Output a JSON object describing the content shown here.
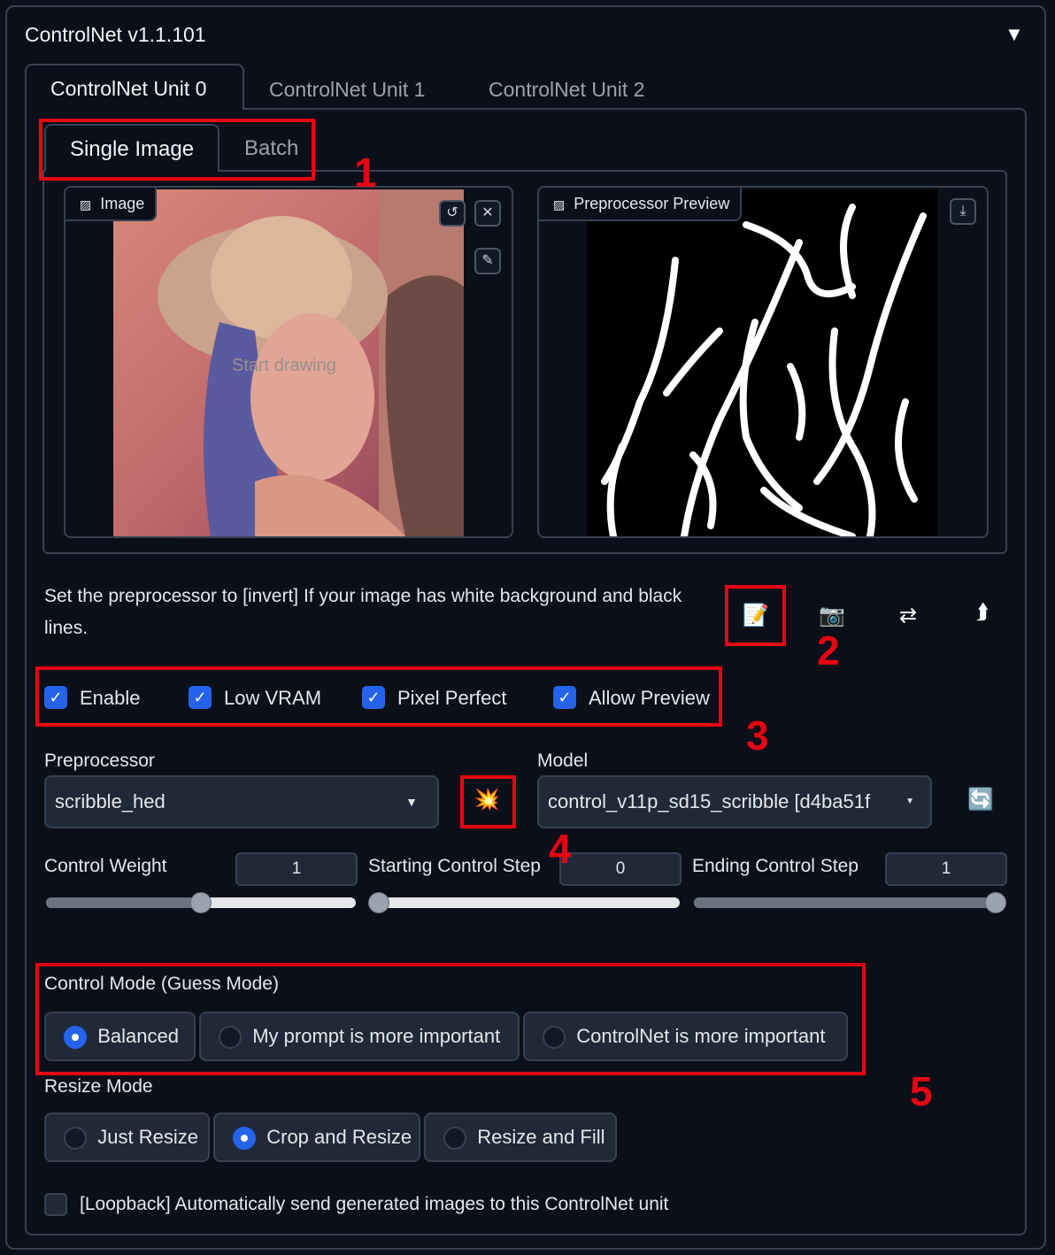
{
  "header": {
    "title": "ControlNet v1.1.101",
    "collapse_icon": "▼"
  },
  "unit_tabs": [
    "ControlNet Unit 0",
    "ControlNet Unit 1",
    "ControlNet Unit 2"
  ],
  "sub_tabs": [
    "Single Image",
    "Batch"
  ],
  "image_panel": {
    "label": "Image",
    "overlay_text": "Start drawing"
  },
  "preview_panel": {
    "label": "Preprocessor Preview"
  },
  "info_text": "Set the preprocessor to [invert] If your image has white background and black lines.",
  "tool_icons": {
    "notepad": "📝",
    "camera": "📷",
    "swap": "⇄",
    "send": "⮭"
  },
  "checkboxes": [
    {
      "label": "Enable",
      "checked": true
    },
    {
      "label": "Low VRAM",
      "checked": true
    },
    {
      "label": "Pixel Perfect",
      "checked": true
    },
    {
      "label": "Allow Preview",
      "checked": true
    }
  ],
  "preprocessor": {
    "label": "Preprocessor",
    "value": "scribble_hed",
    "run_icon": "💥"
  },
  "model": {
    "label": "Model",
    "value": "control_v11p_sd15_scribble [d4ba51f",
    "refresh_icon": "🔄"
  },
  "sliders": [
    {
      "label": "Control Weight",
      "value": "1",
      "fraction": 0.5
    },
    {
      "label": "Starting Control Step",
      "value": "0",
      "fraction": 0.0
    },
    {
      "label": "Ending Control Step",
      "value": "1",
      "fraction": 1.0
    }
  ],
  "control_mode": {
    "label": "Control Mode (Guess Mode)",
    "options": [
      "Balanced",
      "My prompt is more important",
      "ControlNet is more important"
    ],
    "selected": "Balanced"
  },
  "resize_mode": {
    "label": "Resize Mode",
    "options": [
      "Just Resize",
      "Crop and Resize",
      "Resize and Fill"
    ],
    "selected": "Crop and Resize"
  },
  "loopback": {
    "label": "[Loopback] Automatically send generated images to this ControlNet unit",
    "checked": false
  },
  "annotations": [
    "1",
    "2",
    "3",
    "4",
    "5"
  ],
  "colors": {
    "accent": "#2563eb",
    "annotation": "#e40613",
    "background": "#0b0f19"
  }
}
